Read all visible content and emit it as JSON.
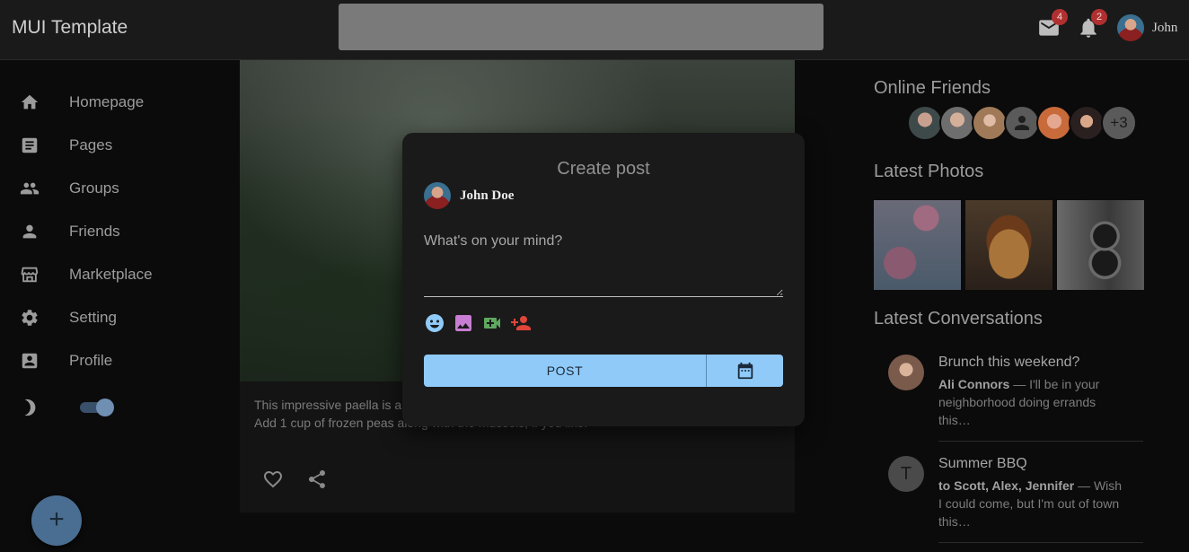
{
  "appbar": {
    "title": "MUI Template",
    "mail_badge": "4",
    "notif_badge": "2",
    "username": "John"
  },
  "sidebar": {
    "items": [
      {
        "label": "Homepage",
        "icon": "home-icon"
      },
      {
        "label": "Pages",
        "icon": "article-icon"
      },
      {
        "label": "Groups",
        "icon": "groups-icon"
      },
      {
        "label": "Friends",
        "icon": "person-icon"
      },
      {
        "label": "Marketplace",
        "icon": "storefront-icon"
      },
      {
        "label": "Setting",
        "icon": "settings-icon"
      },
      {
        "label": "Profile",
        "icon": "account-box-icon"
      }
    ],
    "dark_mode": true,
    "fab_label": "+"
  },
  "feed": {
    "text": "This impressive paella is a perfect party dish and a fun meal to cook together with your guests. Add 1 cup of frozen peas along with the mussels, if you like."
  },
  "modal": {
    "title": "Create post",
    "user_name": "John Doe",
    "placeholder": "What's on your mind?",
    "post_label": "POST"
  },
  "right": {
    "online_title": "Online Friends",
    "more_count": "+3",
    "photos_title": "Latest Photos",
    "conversations_title": "Latest Conversations",
    "conversations": [
      {
        "title": "Brunch this weekend?",
        "from": "Ali Connors",
        "text": " — I'll be in your neighborhood doing errands this…",
        "avatar_letter": ""
      },
      {
        "title": "Summer BBQ",
        "from": "to Scott, Alex, Jennifer",
        "text": " — Wish I could come, but I'm out of town this…",
        "avatar_letter": "T"
      }
    ]
  },
  "colors": {
    "accent": "#90caf9",
    "badge": "#b03030"
  }
}
